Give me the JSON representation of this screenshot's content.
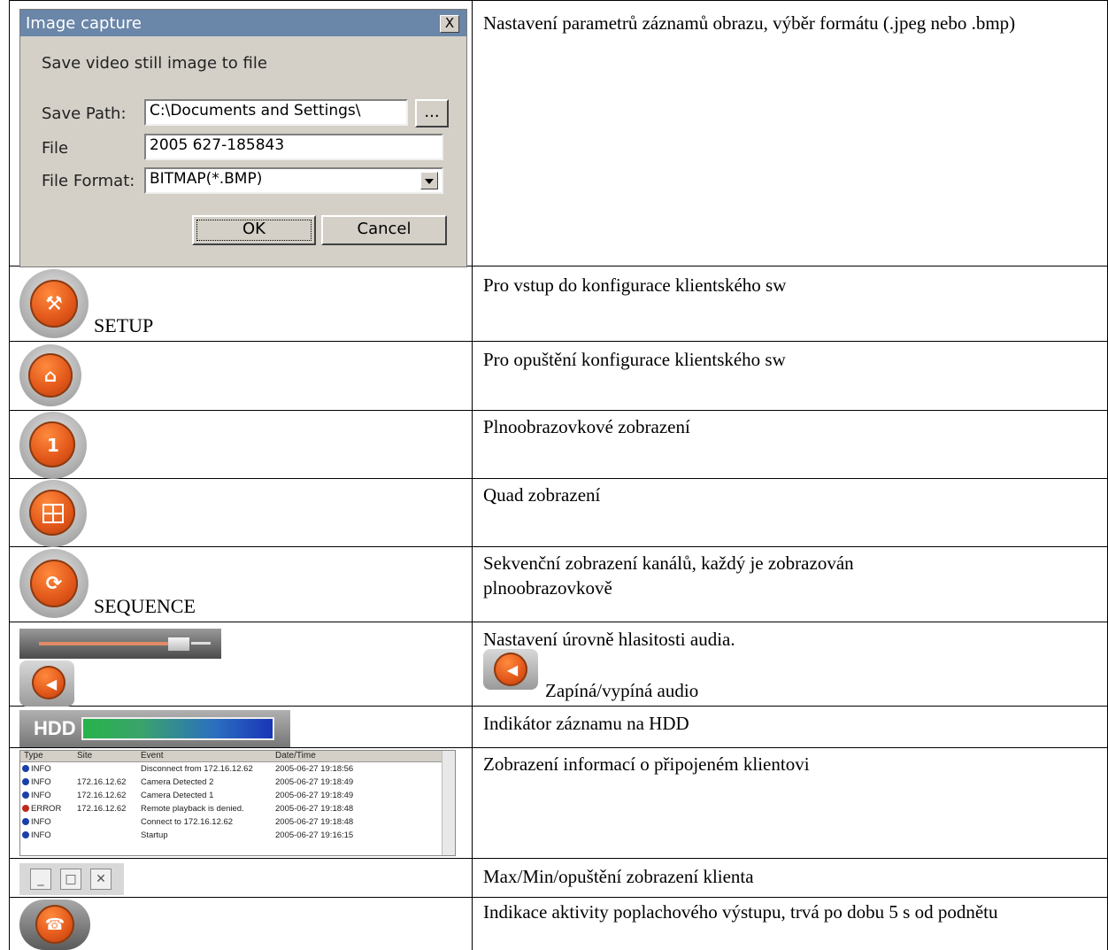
{
  "dialog": {
    "title": "Image capture",
    "close_label": "X",
    "heading": "Save video still image to file",
    "save_path_label": "Save Path:",
    "save_path_value": "C:\\Documents and Settings\\",
    "browse_label": "...",
    "file_label": "File",
    "file_value": "2005 627-185843",
    "format_label": "File Format:",
    "format_value": "BITMAP(*.BMP)",
    "ok_label": "OK",
    "cancel_label": "Cancel"
  },
  "rows": [
    {
      "label": "",
      "desc": "Nastavení parametrů záznamů obrazu, výběr formátu (.jpeg nebo .bmp)"
    },
    {
      "label": "SETUP",
      "desc": "Pro vstup do konfigurace klientského sw"
    },
    {
      "label": "",
      "desc": "Pro opuštění konfigurace klientského sw"
    },
    {
      "label": "",
      "desc": "Plnoobrazovkové zobrazení"
    },
    {
      "label": "",
      "desc": "Quad zobrazení"
    },
    {
      "label": "SEQUENCE",
      "desc": "Sekvenční zobrazení kanálů, každý je zobrazován plnoobrazovkově"
    },
    {
      "label": "",
      "desc": "Nastavení úrovně hlasitosti audia.",
      "desc2": "Zapíná/vypíná audio"
    },
    {
      "label": "",
      "desc": "Indikátor záznamu na HDD"
    },
    {
      "label": "",
      "desc": "Zobrazení informací o připojeném klientovi"
    },
    {
      "label": "",
      "desc": "Max/Min/opuštění zobrazení klienta"
    },
    {
      "label": "",
      "desc": "Indikace aktivity poplachového výstupu, trvá po dobu 5 s od podnětu"
    }
  ],
  "icons": {
    "setup": "tools-icon",
    "exit": "exit-icon",
    "full": "single-view-icon",
    "quad": "quad-view-icon",
    "sequence": "sequence-icon",
    "audio": "speaker-icon",
    "alarm": "alarm-icon",
    "one_glyph": "1"
  },
  "volume_level": 0.68,
  "hdd": {
    "label": "HDD",
    "level": 1.0
  },
  "log": {
    "headers": [
      "Type",
      "Site",
      "Event",
      "Date/Time"
    ],
    "rows": [
      {
        "type": "INFO",
        "site": "",
        "event": "Disconnect from 172.16.12.62",
        "time": "2005-06-27 19:18:56",
        "status_color": "#1a3fa8"
      },
      {
        "type": "INFO",
        "site": "172.16.12.62",
        "event": "Camera Detected 2",
        "time": "2005-06-27 19:18:49",
        "status_color": "#1a3fa8"
      },
      {
        "type": "INFO",
        "site": "172.16.12.62",
        "event": "Camera Detected 1",
        "time": "2005-06-27 19:18:49",
        "status_color": "#1a3fa8"
      },
      {
        "type": "ERROR",
        "site": "172.16.12.62",
        "event": "Remote playback is denied.",
        "time": "2005-06-27 19:18:48",
        "status_color": "#c0281c"
      },
      {
        "type": "INFO",
        "site": "",
        "event": "Connect to 172.16.12.62",
        "time": "2005-06-27 19:18:48",
        "status_color": "#1a3fa8"
      },
      {
        "type": "INFO",
        "site": "",
        "event": "Startup",
        "time": "2005-06-27 19:16:15",
        "status_color": "#1a3fa8"
      }
    ]
  },
  "window_controls": {
    "min": "_",
    "max": "□",
    "close": "✕"
  }
}
